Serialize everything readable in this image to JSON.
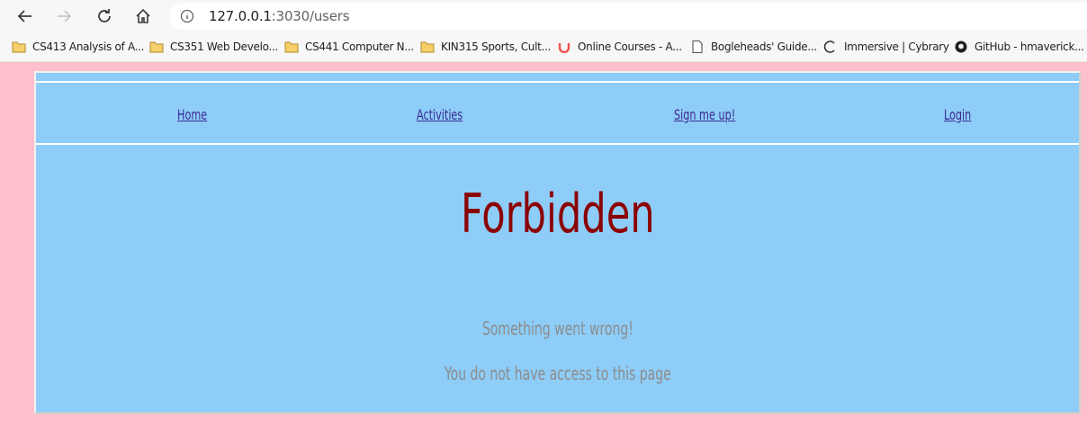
{
  "browser": {
    "url_host": "127.0.0.1",
    "url_rest": ":3030/users",
    "bookmarks": [
      {
        "label": "CS413 Analysis of A...",
        "icon": "folder-icon"
      },
      {
        "label": "CS351 Web Develo...",
        "icon": "folder-icon"
      },
      {
        "label": "CS441 Computer N...",
        "icon": "folder-icon"
      },
      {
        "label": "KIN315 Sports, Cult...",
        "icon": "folder-icon"
      },
      {
        "label": "Online Courses - A...",
        "icon": "udemy-icon"
      },
      {
        "label": "Bogleheads' Guide...",
        "icon": "page-icon"
      },
      {
        "label": "Immersive | Cybrary",
        "icon": "cybrary-icon"
      },
      {
        "label": "GitHub - hmaverick...",
        "icon": "github-icon"
      }
    ]
  },
  "nav": {
    "home": "Home",
    "activities": "Activities",
    "signup": "Sign me up!",
    "login": "Login"
  },
  "page": {
    "title": "Forbidden",
    "message1": "Something went wrong!",
    "message2": "You do not have access to this page"
  },
  "colors": {
    "background": "#ffc0cb",
    "panel": "#8ecdf7",
    "title": "#8b0000",
    "link": "#3b2b94",
    "message": "#8c8c8c"
  }
}
